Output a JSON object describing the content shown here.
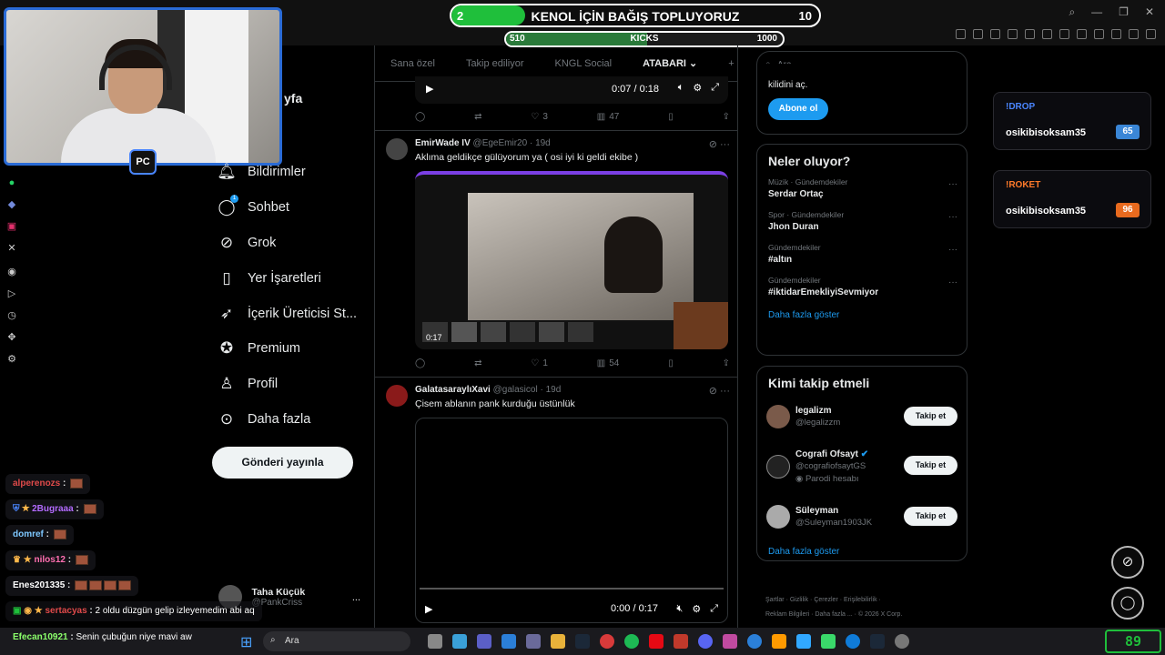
{
  "donation_bar": {
    "left_value": "2",
    "title": "KENOL İÇİN BAĞIŞ TOPLUYORUZ",
    "right_value": "10",
    "progress_fraction": 0.2
  },
  "kicks_bar": {
    "left_value": "510",
    "title": "KICKS",
    "right_value": "1000",
    "progress_fraction": 0.51
  },
  "nav": {
    "home_partial": "yfa",
    "items": [
      {
        "icon": "bell-icon",
        "label": "Bildirimler"
      },
      {
        "icon": "chat-icon",
        "label": "Sohbet",
        "badge": "1"
      },
      {
        "icon": "grok-icon",
        "label": "Grok"
      },
      {
        "icon": "bookmark-icon",
        "label": "Yer İşaretleri"
      },
      {
        "icon": "rocket-icon",
        "label": "İçerik Üreticisi St..."
      },
      {
        "icon": "verified-icon",
        "label": "Premium"
      },
      {
        "icon": "person-icon",
        "label": "Profil"
      },
      {
        "icon": "more-circle-icon",
        "label": "Daha fazla"
      }
    ],
    "post_button": "Gönderi yayınla",
    "profile_name": "Taha Küçük",
    "profile_handle": "@PankCriss",
    "profile_menu": "..."
  },
  "tabs": [
    "Sana özel",
    "Takip ediliyor",
    "KNGL Social",
    "ATABARI",
    "+"
  ],
  "active_tab": "ATABARI",
  "tweets": [
    {
      "player": {
        "time": "0:07 / 0:18"
      },
      "actions": {
        "reply": "",
        "repost": "",
        "likes": "3",
        "views": "47"
      }
    },
    {
      "name": "EmirWade IV",
      "handle": "@EgeEmir20",
      "age": "19d",
      "text": "Aklıma geldikçe gülüyorum ya ( osi iyi ki geldi ekibe )",
      "video_time": "0:17",
      "actions": {
        "reply": "",
        "repost": "",
        "likes": "1",
        "views": "54"
      }
    },
    {
      "name": "GalatasaraylıXavi",
      "handle": "@galasicol",
      "age": "19d",
      "text": "Çisem ablanın pank kurduğu üstünlük",
      "player": {
        "time": "0:00 / 0:17"
      }
    }
  ],
  "right": {
    "search_placeholder": "Ara",
    "subscribe_text": "kilidini aç.",
    "subscribe_button": "Abone ol",
    "trending_title": "Neler oluyor?",
    "trends": [
      {
        "category": "Müzik · Gündemdekiler",
        "title": "Serdar Ortaç"
      },
      {
        "category": "Spor · Gündemdekiler",
        "title": "Jhon Duran"
      },
      {
        "category": "Gündemdekiler",
        "title": "#altın"
      },
      {
        "category": "Gündemdekiler",
        "title": "#iktidarEmekliyiSevmiyor"
      }
    ],
    "show_more": "Daha fazla göster",
    "who_title": "Kimi takip etmeli",
    "who": [
      {
        "name": "legalizm",
        "handle": "@legalizzm"
      },
      {
        "name": "Cografi Ofsayt",
        "handle": "@cografiofsaytGS",
        "extra": "Parodi hesabı"
      },
      {
        "name": "Süleyman",
        "handle": "@Suleyman1903JK"
      }
    ],
    "follow_label": "Takip et",
    "footer": [
      "Şartlar",
      "Gizlilik",
      "Çerezler",
      "Erişilebilirlik",
      "Reklam Bilgileri",
      "Daha fazla ...",
      "© 2026 X Corp."
    ]
  },
  "overlay": {
    "drop": {
      "title": "!DROP",
      "name": "osikibisoksam35",
      "count": "65"
    },
    "roket": {
      "title": "!ROKET",
      "name": "osikibisoksam35",
      "count": "96"
    }
  },
  "chat": [
    {
      "user": "alperenozs",
      "color": "#e04a4a",
      "msg": ""
    },
    {
      "user": "2Bugraaa",
      "color": "#b36bff",
      "msg": ""
    },
    {
      "user": "domref",
      "color": "#7ec8ff",
      "msg": ""
    },
    {
      "user": "nilos12",
      "color": "#ff6fb0",
      "msg": ""
    },
    {
      "user": "Enes201335",
      "color": "#ffffff",
      "msg": ""
    },
    {
      "user": "sertacyas",
      "color": "#e04a4a",
      "msg": "2 oldu düzgün gelip izleyemedim abi aq"
    },
    {
      "user": "Efecan10921",
      "color": "#8bff6b",
      "msg": "Senin çubuğun niye mavi aw"
    }
  ],
  "taskbar": {
    "search": "Ara",
    "clock": "89"
  }
}
